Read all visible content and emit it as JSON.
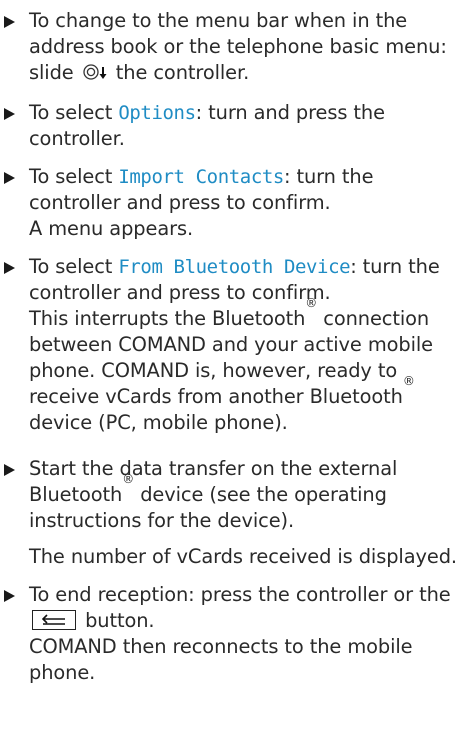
{
  "steps": [
    {
      "before": "To change to the menu bar when in the address book or the telephone basic menu: slide",
      "after": "the controller."
    },
    {
      "before": "To select ",
      "menu": "Options",
      "after": ": turn and press the controller."
    },
    {
      "before": "To select ",
      "menu": "Import Contacts",
      "after": ": turn the controller and press to confirm.",
      "note": "A menu appears."
    },
    {
      "before": "To select ",
      "menu": "From Bluetooth Device",
      "after": ": turn the controller and press to confirm.",
      "note_1": "This interrupts the Bluetooth",
      "note_2": " connection between COMAND and your active mobile phone. COMAND is, however, ready to receive vCards from another Bluetooth",
      "note_3": " device (PC, mobile phone)."
    },
    {
      "part_1": "Start the data transfer on the external Bluetooth",
      "part_2": " device (see the operating instructions for the device).",
      "note": "The number of vCards received is displayed."
    },
    {
      "before": "To end reception: press the controller or the",
      "after": "button.",
      "note": "COMAND then reconnects to the mobile phone."
    }
  ],
  "reg_symbol": "®",
  "icons": {
    "slide": "controller-slide-down-icon",
    "back": "back-button-icon"
  },
  "colors": {
    "menu_text": "#1f8cc4"
  }
}
